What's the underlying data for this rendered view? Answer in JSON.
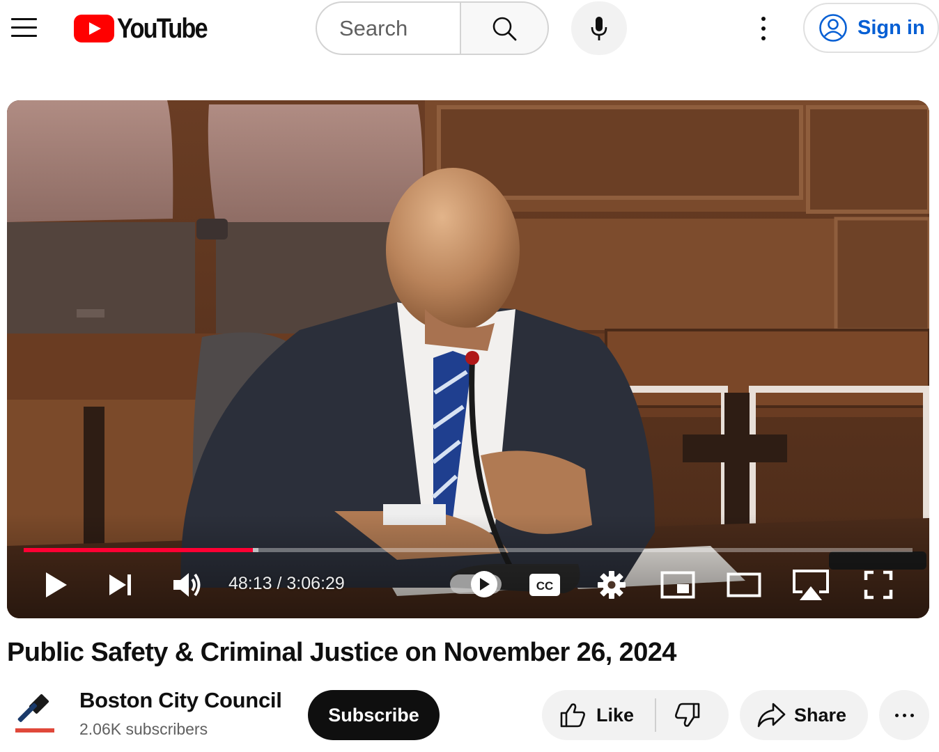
{
  "header": {
    "logo_text": "YouTube",
    "search_placeholder": "Search",
    "signin_label": "Sign in",
    "icons": [
      "menu-icon",
      "search-icon",
      "microphone-icon",
      "more-vert-icon",
      "account-icon"
    ]
  },
  "player": {
    "time_current": "48:13",
    "time_separator": " / ",
    "time_total": "3:06:29",
    "progress_played_fraction": 0.2578,
    "progress_loaded_fraction": 0.264,
    "autoplay_on": true,
    "cc_label": "CC",
    "icons": [
      "play-icon",
      "next-icon",
      "volume-icon",
      "autoplay-toggle-icon",
      "captions-icon",
      "settings-icon",
      "miniplayer-icon",
      "theater-mode-icon",
      "airplay-icon",
      "fullscreen-icon"
    ],
    "progress_color": "#ff0033"
  },
  "video": {
    "title": "Public Safety & Criminal Justice on November 26, 2024"
  },
  "channel": {
    "name": "Boston City Council",
    "subscribers": "2.06K subscribers",
    "subscribe_label": "Subscribe"
  },
  "actions": {
    "like_label": "Like",
    "share_label": "Share",
    "icons": [
      "thumbs-up-icon",
      "thumbs-down-icon",
      "share-icon",
      "more-horiz-icon"
    ]
  },
  "colors": {
    "brand_red": "#ff0000",
    "link_blue": "#065fd4",
    "subscribe_bg": "#0f0f0f"
  }
}
